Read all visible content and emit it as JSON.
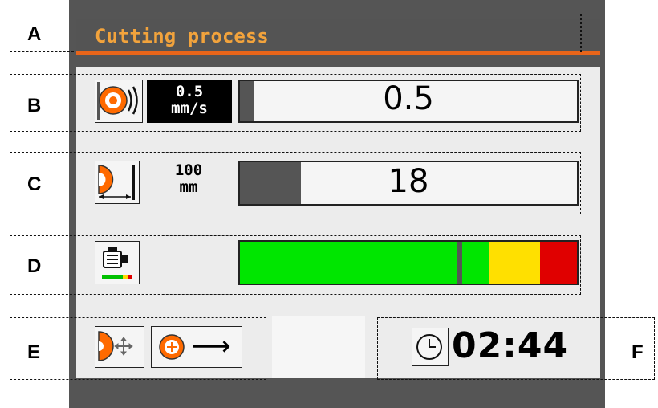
{
  "title": "Cutting process",
  "callouts": [
    "A",
    "B",
    "C",
    "D",
    "E",
    "F"
  ],
  "speed": {
    "icon": "cutting-speed-icon",
    "setpoint_value": "0.5",
    "setpoint_unit": "mm/s",
    "current": "0.5",
    "fill_fraction": 0.04
  },
  "length": {
    "icon": "cut-length-icon",
    "setpoint_value": "100",
    "setpoint_unit": "mm",
    "current": "18",
    "fill_fraction": 0.18
  },
  "motor": {
    "icon": "motor-load-icon",
    "load_fraction": 0.645,
    "zones": [
      {
        "color": "#00e600",
        "fraction": 0.74
      },
      {
        "color": "#ffe000",
        "fraction": 0.15
      },
      {
        "color": "#e00000",
        "fraction": 0.11
      }
    ]
  },
  "feed": {
    "icon": "blade-positioning-icon",
    "mode_icon": "move-direction-icon",
    "direction_arrow": "⟶"
  },
  "timer": {
    "icon": "clock-icon",
    "time": "02:44"
  },
  "colors": {
    "title_text": "#f2a33c",
    "title_line": "#e8651a",
    "blade": "#ff6a00"
  }
}
